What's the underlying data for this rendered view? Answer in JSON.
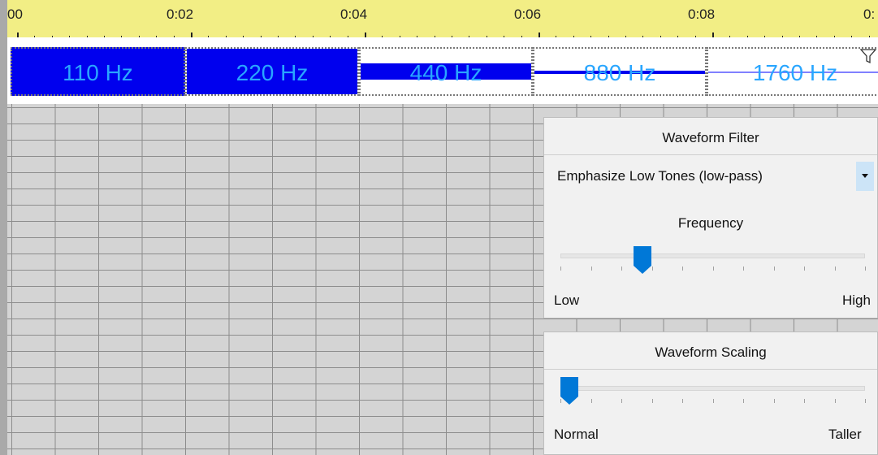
{
  "timeline": {
    "ticks": [
      "00",
      "0:02",
      "0:04",
      "0:06",
      "0:08",
      "0:"
    ]
  },
  "waveform": {
    "segments": [
      "110 Hz",
      "220 Hz",
      "440 Hz",
      "880 Hz",
      "1760 Hz"
    ]
  },
  "filter_panel": {
    "title": "Waveform Filter",
    "selected_filter": "Emphasize Low Tones (low-pass)",
    "frequency_label": "Frequency",
    "low_label": "Low",
    "high_label": "High",
    "frequency_level": 0.27
  },
  "scaling_panel": {
    "title": "Waveform Scaling",
    "normal_label": "Normal",
    "taller_label": "Taller",
    "scaling_level": 0.03
  },
  "colors": {
    "ruler": "#f2ee85",
    "segment_fill": "#0000ee",
    "segment_text": "#29a6ff",
    "slider_thumb": "#0078d7"
  }
}
